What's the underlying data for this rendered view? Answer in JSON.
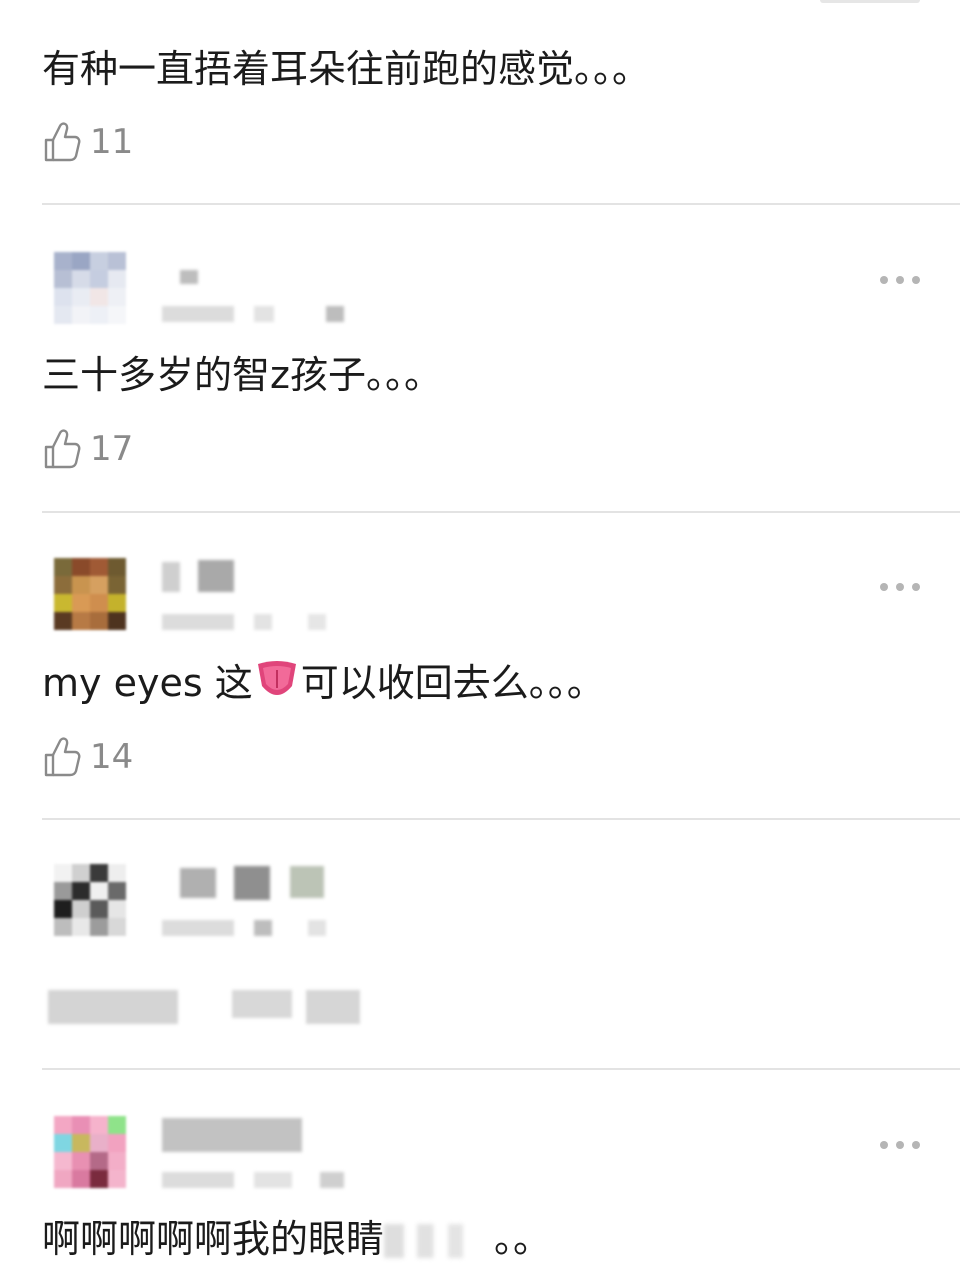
{
  "comments": [
    {
      "text": "有种一直捂着耳朵往前跑的感觉。。。",
      "likes": "11"
    },
    {
      "text": "三十多岁的智z孩子。。。",
      "likes": "17"
    },
    {
      "text_before_emoji": "my eyes 这",
      "emoji": "tongue-emoji",
      "text_after_emoji": "可以收回去么。。。",
      "likes": "14"
    },
    {
      "text": "啊啊啊啊啊我的眼睛",
      "text_tail": "。。"
    }
  ],
  "icons": {
    "like": "thumbs-up-icon",
    "more": "more-dots-icon"
  },
  "colors": {
    "text": "#1b1b1b",
    "like_count": "#8a8a8a",
    "divider": "#e3e3e3",
    "more_dots": "#b5b5b5",
    "emoji_pink": "#e0457b"
  }
}
